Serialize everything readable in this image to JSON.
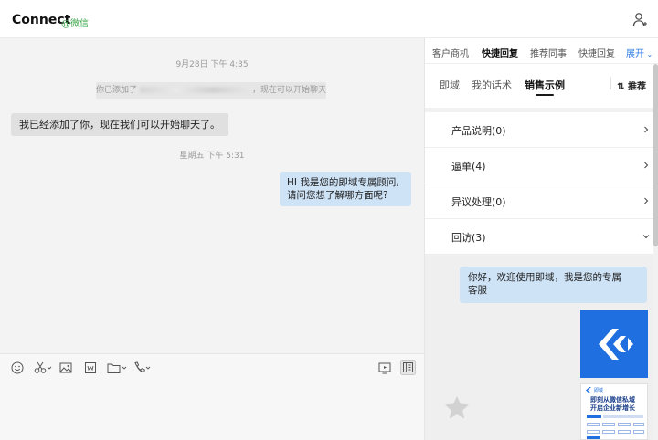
{
  "header": {
    "contact_name": "Connect",
    "contact_tag": "@微信",
    "person_icon": "person-icon"
  },
  "chat": {
    "messages": [
      {
        "type": "timestamp",
        "text": "9月28日 下午 4:35"
      },
      {
        "type": "system",
        "prefix": "你已添加了",
        "suffix": "，现在可以开始聊天了。"
      },
      {
        "type": "incoming",
        "text": "我已经添加了你，现在我们可以开始聊天了。"
      },
      {
        "type": "timestamp",
        "text": "星期五 下午 5:31"
      },
      {
        "type": "outgoing",
        "line1": "HI  我是您的即域专属顾问,",
        "line2": "请问您想了解哪方面呢?"
      }
    ]
  },
  "composer": {
    "tools": [
      "emoji-icon",
      "scissors-icon",
      "image-icon",
      "word-file-icon",
      "folder-icon",
      "phone-icon",
      "screen-share-icon",
      "sidebar-toggle-icon"
    ]
  },
  "right_panel": {
    "top_tabs": [
      "客户商机",
      "快捷回复",
      "推荐同事",
      "快捷回复",
      "展开"
    ],
    "active_top_tab": "快捷回复",
    "sub_tabs": [
      "即域",
      "我的话术",
      "销售示例"
    ],
    "active_sub_tab": "销售示例",
    "recommend_label": "推荐",
    "categories": [
      {
        "label": "产品说明(0)",
        "state": "collapsed"
      },
      {
        "label": "逼单(4)",
        "state": "collapsed"
      },
      {
        "label": "异议处理(0)",
        "state": "collapsed"
      },
      {
        "label": "回访(3)",
        "state": "expanded"
      }
    ],
    "reply_preview": {
      "line1": "你好，欢迎使用即域，我是您的专属",
      "line2": "客服"
    },
    "poster": {
      "brand": "即域",
      "title_line1": "即刻从微信私域",
      "title_line2": "开启企业新增长"
    }
  },
  "colors": {
    "accent_blue": "#2f7de1",
    "bubble_blue": "#cfe3f7",
    "logo_blue": "#1f6fe0",
    "wechat_green": "#3aa649"
  }
}
